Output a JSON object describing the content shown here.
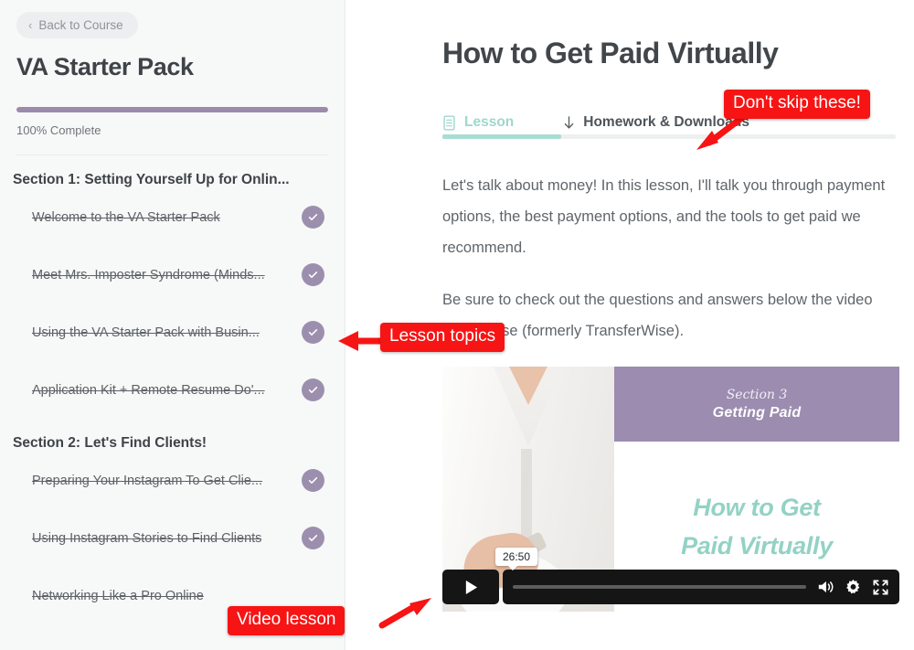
{
  "sidebar": {
    "back_label": "Back to Course",
    "back_icon": "chevron-left-icon",
    "course_title": "VA Starter Pack",
    "progress_percent": 100,
    "progress_label": "100% Complete",
    "progress_color": "#9b8aab",
    "sections": [
      {
        "heading": "Section 1: Setting Yourself Up for Onlin...",
        "lessons": [
          {
            "title": "Welcome to the VA Starter Pack",
            "completed": true
          },
          {
            "title": "Meet Mrs. Imposter Syndrome (Minds...",
            "completed": true
          },
          {
            "title": "Using the VA Starter Pack with Busin...",
            "completed": true
          },
          {
            "title": "Application Kit + Remote Resume Do'...",
            "completed": true
          }
        ]
      },
      {
        "heading": "Section 2: Let's Find Clients!",
        "lessons": [
          {
            "title": "Preparing Your Instagram To Get Clie...",
            "completed": true
          },
          {
            "title": "Using Instagram Stories to Find Clients",
            "completed": true
          },
          {
            "title": "Networking Like a Pro Online",
            "completed": true
          }
        ]
      }
    ]
  },
  "main": {
    "lesson_title": "How to Get Paid Virtually",
    "tabs": [
      {
        "label": "Lesson",
        "icon": "document-icon",
        "active": true
      },
      {
        "label": "Homework & Downloads",
        "icon": "arrow-down-icon",
        "active": false
      }
    ],
    "paragraphs": [
      "Let's talk about money! In this lesson, I'll talk you through payment options, the best payment options, and the tools to get paid we recommend.",
      "Be sure to check out the questions and answers below the video about Wise (formerly TransferWise)."
    ],
    "video": {
      "slide_section": "Section 3",
      "slide_subtitle": "Getting Paid",
      "slide_headline_line1": "How to Get",
      "slide_headline_line2": "Paid Virtually",
      "banner_color": "#9b8cb0",
      "headline_color": "#93d2c4",
      "controls": {
        "play_icon": "play-icon",
        "time_tooltip": "26:50",
        "volume_icon": "volume-icon",
        "settings_icon": "gear-icon",
        "fullscreen_icon": "fullscreen-icon"
      }
    }
  },
  "annotations": {
    "accent_color": "#f71414",
    "items": [
      {
        "text": "Don't skip these!"
      },
      {
        "text": "Lesson topics"
      },
      {
        "text": "Video lesson"
      }
    ]
  }
}
